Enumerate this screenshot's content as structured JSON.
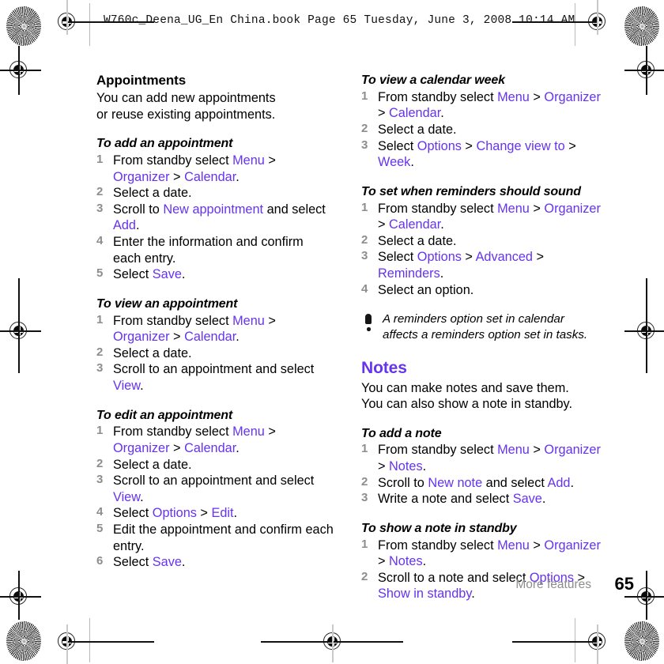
{
  "header": {
    "book_line": "W760c_Deena_UG_En China.book  Page 65  Tuesday, June 3, 2008  10:14 AM"
  },
  "colors": {
    "link": "#6633ee",
    "step_number": "#8d8d8d",
    "footer_label": "#8d8d8d",
    "text": "#000000"
  },
  "left_column": {
    "section_heading": "Appointments",
    "intro_line_1": "You can add new appointments",
    "intro_line_2": "or reuse existing appointments.",
    "procedures": [
      {
        "title": "To add an appointment",
        "steps": [
          {
            "num": "1",
            "parts": [
              {
                "t": "From standby select ",
                "k": "plain"
              },
              {
                "t": "Menu",
                "k": "link"
              },
              {
                "t": " > ",
                "k": "plain"
              },
              {
                "t": "Organizer",
                "k": "link"
              },
              {
                "t": " > ",
                "k": "plain"
              },
              {
                "t": "Calendar",
                "k": "link"
              },
              {
                "t": ".",
                "k": "plain"
              }
            ]
          },
          {
            "num": "2",
            "parts": [
              {
                "t": "Select a date.",
                "k": "plain"
              }
            ]
          },
          {
            "num": "3",
            "parts": [
              {
                "t": "Scroll to ",
                "k": "plain"
              },
              {
                "t": "New appointment",
                "k": "link"
              },
              {
                "t": " and select ",
                "k": "plain"
              },
              {
                "t": "Add",
                "k": "link"
              },
              {
                "t": ".",
                "k": "plain"
              }
            ]
          },
          {
            "num": "4",
            "parts": [
              {
                "t": "Enter the information and confirm each entry.",
                "k": "plain"
              }
            ]
          },
          {
            "num": "5",
            "parts": [
              {
                "t": "Select ",
                "k": "plain"
              },
              {
                "t": "Save",
                "k": "link"
              },
              {
                "t": ".",
                "k": "plain"
              }
            ]
          }
        ]
      },
      {
        "title": "To view an appointment",
        "steps": [
          {
            "num": "1",
            "parts": [
              {
                "t": "From standby select ",
                "k": "plain"
              },
              {
                "t": "Menu",
                "k": "link"
              },
              {
                "t": " > ",
                "k": "plain"
              },
              {
                "t": "Organizer",
                "k": "link"
              },
              {
                "t": " > ",
                "k": "plain"
              },
              {
                "t": "Calendar",
                "k": "link"
              },
              {
                "t": ".",
                "k": "plain"
              }
            ]
          },
          {
            "num": "2",
            "parts": [
              {
                "t": "Select a date.",
                "k": "plain"
              }
            ]
          },
          {
            "num": "3",
            "parts": [
              {
                "t": "Scroll to an appointment and select ",
                "k": "plain"
              },
              {
                "t": "View",
                "k": "link"
              },
              {
                "t": ".",
                "k": "plain"
              }
            ]
          }
        ]
      },
      {
        "title": "To edit an appointment",
        "steps": [
          {
            "num": "1",
            "parts": [
              {
                "t": "From standby select ",
                "k": "plain"
              },
              {
                "t": "Menu",
                "k": "link"
              },
              {
                "t": " > ",
                "k": "plain"
              },
              {
                "t": "Organizer",
                "k": "link"
              },
              {
                "t": " > ",
                "k": "plain"
              },
              {
                "t": "Calendar",
                "k": "link"
              },
              {
                "t": ".",
                "k": "plain"
              }
            ]
          },
          {
            "num": "2",
            "parts": [
              {
                "t": "Select a date.",
                "k": "plain"
              }
            ]
          },
          {
            "num": "3",
            "parts": [
              {
                "t": "Scroll to an appointment and select ",
                "k": "plain"
              },
              {
                "t": "View",
                "k": "link"
              },
              {
                "t": ".",
                "k": "plain"
              }
            ]
          },
          {
            "num": "4",
            "parts": [
              {
                "t": "Select ",
                "k": "plain"
              },
              {
                "t": "Options",
                "k": "link"
              },
              {
                "t": " > ",
                "k": "plain"
              },
              {
                "t": "Edit",
                "k": "link"
              },
              {
                "t": ".",
                "k": "plain"
              }
            ]
          },
          {
            "num": "5",
            "parts": [
              {
                "t": "Edit the appointment and confirm each entry.",
                "k": "plain"
              }
            ]
          },
          {
            "num": "6",
            "parts": [
              {
                "t": "Select ",
                "k": "plain"
              },
              {
                "t": "Save",
                "k": "link"
              },
              {
                "t": ".",
                "k": "plain"
              }
            ]
          }
        ]
      }
    ]
  },
  "right_column": {
    "procedures_top": [
      {
        "title": "To view a calendar week",
        "steps": [
          {
            "num": "1",
            "parts": [
              {
                "t": "From standby select ",
                "k": "plain"
              },
              {
                "t": "Menu",
                "k": "link"
              },
              {
                "t": " > ",
                "k": "plain"
              },
              {
                "t": "Organizer",
                "k": "link"
              },
              {
                "t": " > ",
                "k": "plain"
              },
              {
                "t": "Calendar",
                "k": "link"
              },
              {
                "t": ".",
                "k": "plain"
              }
            ]
          },
          {
            "num": "2",
            "parts": [
              {
                "t": "Select a date.",
                "k": "plain"
              }
            ]
          },
          {
            "num": "3",
            "parts": [
              {
                "t": "Select ",
                "k": "plain"
              },
              {
                "t": "Options",
                "k": "link"
              },
              {
                "t": " > ",
                "k": "plain"
              },
              {
                "t": "Change view to",
                "k": "link"
              },
              {
                "t": " > ",
                "k": "plain"
              },
              {
                "t": "Week",
                "k": "link"
              },
              {
                "t": ".",
                "k": "plain"
              }
            ]
          }
        ]
      },
      {
        "title": "To set when reminders should sound",
        "steps": [
          {
            "num": "1",
            "parts": [
              {
                "t": "From standby select ",
                "k": "plain"
              },
              {
                "t": "Menu",
                "k": "link"
              },
              {
                "t": " > ",
                "k": "plain"
              },
              {
                "t": "Organizer",
                "k": "link"
              },
              {
                "t": " > ",
                "k": "plain"
              },
              {
                "t": "Calendar",
                "k": "link"
              },
              {
                "t": ".",
                "k": "plain"
              }
            ]
          },
          {
            "num": "2",
            "parts": [
              {
                "t": "Select a date.",
                "k": "plain"
              }
            ]
          },
          {
            "num": "3",
            "parts": [
              {
                "t": "Select ",
                "k": "plain"
              },
              {
                "t": "Options",
                "k": "link"
              },
              {
                "t": " > ",
                "k": "plain"
              },
              {
                "t": "Advanced",
                "k": "link"
              },
              {
                "t": " > ",
                "k": "plain"
              },
              {
                "t": "Reminders",
                "k": "link"
              },
              {
                "t": ".",
                "k": "plain"
              }
            ]
          },
          {
            "num": "4",
            "parts": [
              {
                "t": "Select an option.",
                "k": "plain"
              }
            ]
          }
        ]
      }
    ],
    "note": {
      "icon": "exclamation-icon",
      "line_1": "A reminders option set in calendar",
      "line_2": "affects a reminders option set in tasks."
    },
    "section_heading": "Notes",
    "intro_line_1": "You can make notes and save them.",
    "intro_line_2": "You can also show a note in standby.",
    "procedures_bottom": [
      {
        "title": "To add a note",
        "steps": [
          {
            "num": "1",
            "parts": [
              {
                "t": "From standby select ",
                "k": "plain"
              },
              {
                "t": "Menu",
                "k": "link"
              },
              {
                "t": " > ",
                "k": "plain"
              },
              {
                "t": "Organizer",
                "k": "link"
              },
              {
                "t": " > ",
                "k": "plain"
              },
              {
                "t": "Notes",
                "k": "link"
              },
              {
                "t": ".",
                "k": "plain"
              }
            ]
          },
          {
            "num": "2",
            "parts": [
              {
                "t": "Scroll to ",
                "k": "plain"
              },
              {
                "t": "New note",
                "k": "link"
              },
              {
                "t": " and select ",
                "k": "plain"
              },
              {
                "t": "Add",
                "k": "link"
              },
              {
                "t": ".",
                "k": "plain"
              }
            ]
          },
          {
            "num": "3",
            "parts": [
              {
                "t": "Write a note and select ",
                "k": "plain"
              },
              {
                "t": "Save",
                "k": "link"
              },
              {
                "t": ".",
                "k": "plain"
              }
            ]
          }
        ]
      },
      {
        "title": "To show a note in standby",
        "steps": [
          {
            "num": "1",
            "parts": [
              {
                "t": "From standby select ",
                "k": "plain"
              },
              {
                "t": "Menu",
                "k": "link"
              },
              {
                "t": " > ",
                "k": "plain"
              },
              {
                "t": "Organizer",
                "k": "link"
              },
              {
                "t": " > ",
                "k": "plain"
              },
              {
                "t": "Notes",
                "k": "link"
              },
              {
                "t": ".",
                "k": "plain"
              }
            ]
          },
          {
            "num": "2",
            "parts": [
              {
                "t": "Scroll to a note and select ",
                "k": "plain"
              },
              {
                "t": "Options",
                "k": "link"
              },
              {
                "t": " > ",
                "k": "plain"
              },
              {
                "t": "Show in standby",
                "k": "link"
              },
              {
                "t": ".",
                "k": "plain"
              }
            ]
          }
        ]
      }
    ]
  },
  "footer": {
    "label": "More features",
    "page_number": "65"
  }
}
